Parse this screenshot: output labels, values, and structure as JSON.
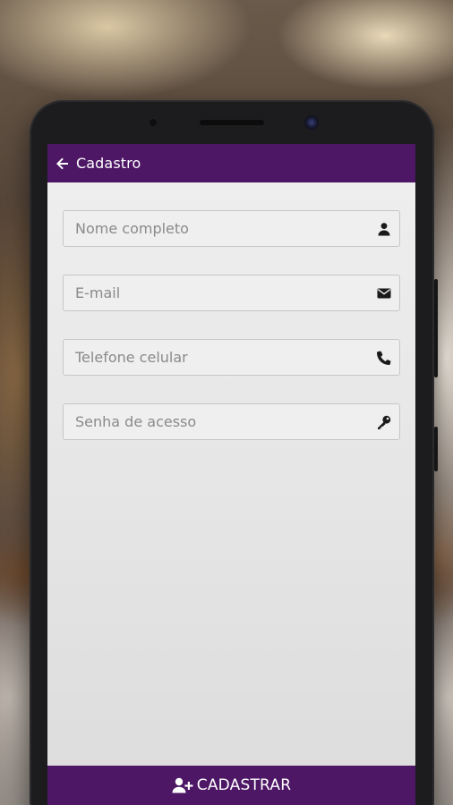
{
  "appbar": {
    "title": "Cadastro",
    "back_icon": "arrow-left-icon",
    "color": "#4d1766"
  },
  "form": {
    "fields": [
      {
        "placeholder": "Nome completo",
        "value": "",
        "icon": "user-icon"
      },
      {
        "placeholder": "E-mail",
        "value": "",
        "icon": "envelope-icon"
      },
      {
        "placeholder": "Telefone celular",
        "value": "",
        "icon": "phone-icon"
      },
      {
        "placeholder": "Senha de acesso",
        "value": "",
        "icon": "key-icon"
      }
    ]
  },
  "submit": {
    "label": "CADASTRAR",
    "icon": "user-plus-icon"
  }
}
